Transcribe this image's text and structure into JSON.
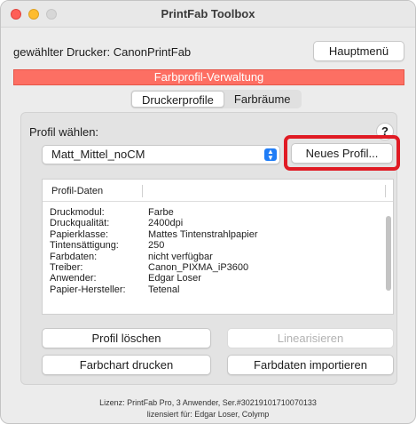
{
  "window": {
    "title": "PrintFab Toolbox"
  },
  "printer": {
    "label": "gewählter Drucker: CanonPrintFab"
  },
  "buttons": {
    "main_menu": "Hauptmenü",
    "new_profile": "Neues Profil...",
    "delete_profile": "Profil löschen",
    "linearize": "Linearisieren",
    "print_chart": "Farbchart drucken",
    "import_data": "Farbdaten importieren"
  },
  "banner": {
    "text": "Farbprofil-Verwaltung"
  },
  "tabs": [
    {
      "label": "Druckerprofile",
      "active": true
    },
    {
      "label": "Farbräume",
      "active": false
    }
  ],
  "profile": {
    "label": "Profil wählen:",
    "selected": "Matt_Mittel_noCM",
    "help": "?"
  },
  "table": {
    "header": "Profil-Daten",
    "rows": [
      {
        "key": "Druckmodul:",
        "value": "Farbe"
      },
      {
        "key": "Druckqualität:",
        "value": "2400dpi"
      },
      {
        "key": "Papierklasse:",
        "value": "Mattes Tintenstrahlpapier"
      },
      {
        "key": "Tintensättigung:",
        "value": "250"
      },
      {
        "key": "Farbdaten:",
        "value": "nicht verfügbar"
      },
      {
        "key": "Treiber:",
        "value": "Canon_PIXMA_iP3600"
      },
      {
        "key": "Anwender:",
        "value": "Edgar Loser"
      },
      {
        "key": "Papier-Hersteller:",
        "value": "Tetenal"
      }
    ]
  },
  "footer": {
    "line1": "Lizenz: PrintFab Pro, 3 Anwender, Ser.#30219101710070133",
    "line2": "lizensiert für: Edgar Loser, Colymp"
  },
  "colors": {
    "banner": "#fd6f63",
    "highlight": "#e01b24",
    "select_accent": "#1f7cf6"
  }
}
